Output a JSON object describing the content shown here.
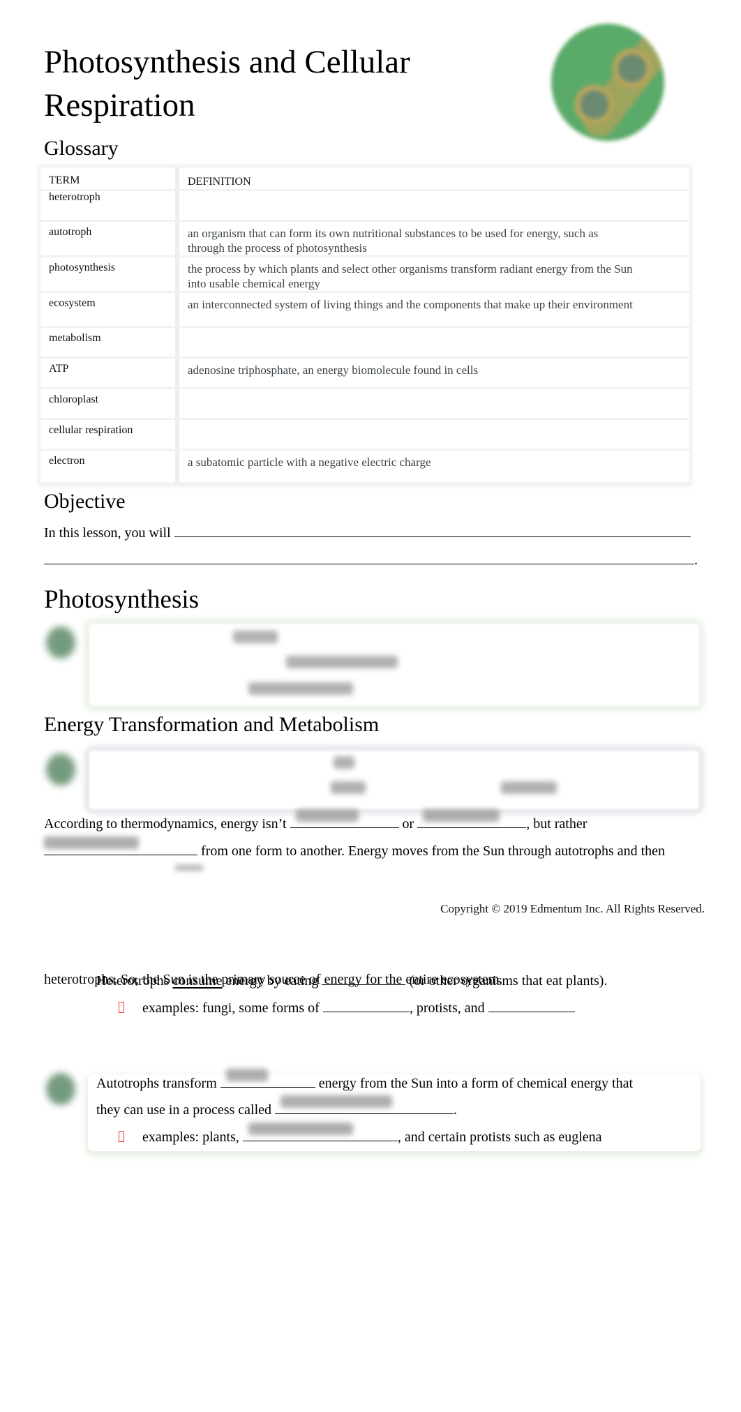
{
  "document": {
    "title": "Photosynthesis and Cellular Respiration",
    "logo_icon": "cell-division-icon"
  },
  "glossary": {
    "heading": "Glossary",
    "columns": [
      "TERM",
      "DEFINITION"
    ],
    "rows": [
      {
        "term": "heterotroph",
        "definition": ""
      },
      {
        "term": "autotroph",
        "definition": "an organism that can form its own nutritional substances to be used for energy, such as through the process of photosynthesis"
      },
      {
        "term": "photosynthesis",
        "definition": "the process by which plants and select other organisms transform radiant energy from the Sun into usable chemical energy"
      },
      {
        "term": "ecosystem",
        "definition": "an interconnected system of living things and the components that make up their environment"
      },
      {
        "term": "metabolism",
        "definition": ""
      },
      {
        "term": "ATP",
        "definition": "adenosine triphosphate, an energy biomolecule found in cells"
      },
      {
        "term": "chloroplast",
        "definition": ""
      },
      {
        "term": "cellular respiration",
        "definition": ""
      },
      {
        "term": "electron",
        "definition": "a subatomic particle with a negative electric charge"
      }
    ]
  },
  "objective": {
    "heading": "Objective",
    "prefix": "In this lesson, you will",
    "suffix": "."
  },
  "photosynthesis": {
    "heading": "Photosynthesis"
  },
  "energy": {
    "heading": "Energy Transformation and Metabolism",
    "para_line1_a": "According to thermodynamics, energy isn’t",
    "para_line1_b": "or",
    "para_line1_c": ", but rather",
    "para_line2": "from one form to another. Energy moves from the Sun through autotrophs and then"
  },
  "footer": {
    "copyright": "Copyright © 2019 Edmentum Inc. All Rights Reserved."
  },
  "page2": {
    "overlap_line_a": "heterotrophs. So, the Sun is the primary source of energy for the entire ecosystem.",
    "overlap_line_b_pre": "Heterotrophs",
    "overlap_line_b_u1": "consume",
    "overlap_line_b_mid": "energy by eating",
    "overlap_line_b_post": "(or other organisms that eat plants).",
    "hetero_examples_a": "examples: fungi, some forms of",
    "hetero_examples_b": ", protists, and",
    "auto_line1_a": "Autotrophs transform",
    "auto_line1_b": "energy from the Sun into a form of chemical energy that",
    "auto_line2_a": "they can use in a process called",
    "auto_line2_b": ".",
    "auto_examples_a": "examples: plants,",
    "auto_examples_b": ", and certain protists such as euglena"
  },
  "colors": {
    "logo_green": "#5aaa6a",
    "bullet_red": "#e03a3a",
    "definition_text": "#3c4348"
  }
}
